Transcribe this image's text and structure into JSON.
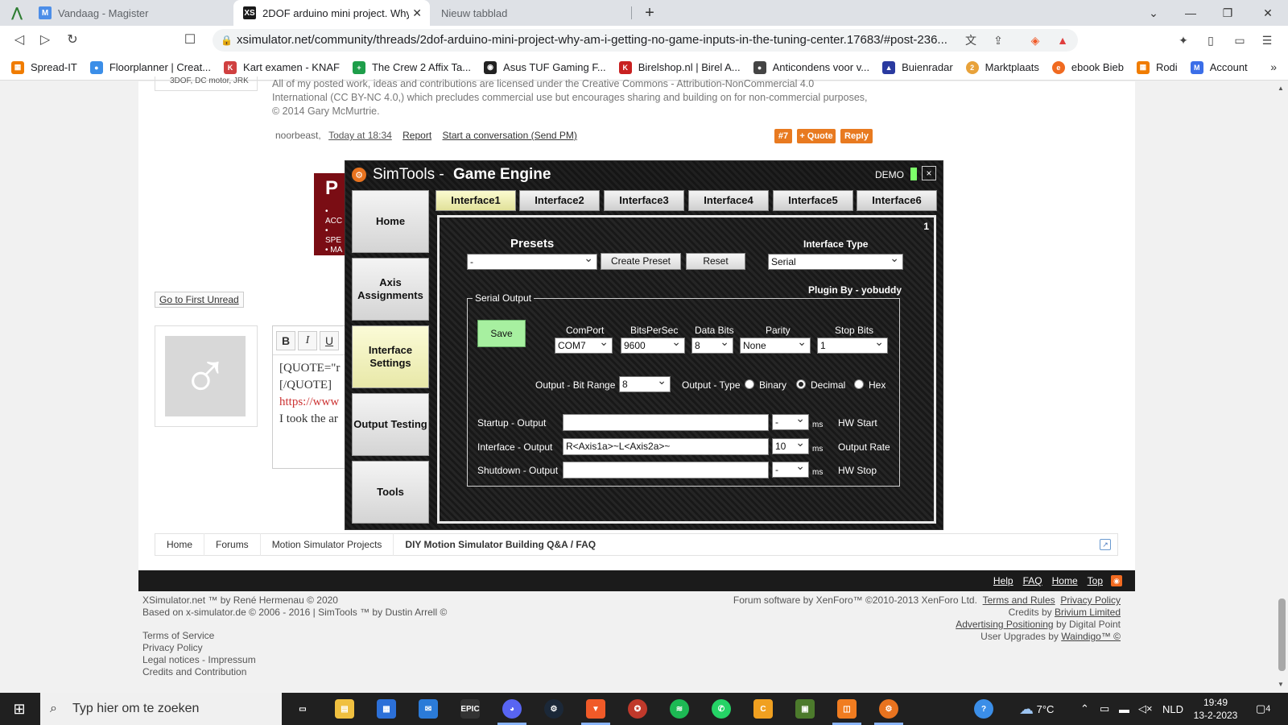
{
  "browser": {
    "tabs": [
      {
        "title": "Vandaag - Magister",
        "icon": "M",
        "color": "#4c8ee8"
      },
      {
        "title": "2DOF arduino mini project. Why a",
        "icon": "XS",
        "color": "#1a1a1a"
      },
      {
        "title": "Nieuw tabblad"
      }
    ],
    "url": "xsimulator.net/community/threads/2dof-arduino-mini-project-why-am-i-getting-no-game-inputs-in-the-tuning-center.17683/#post-236...",
    "bookmarks": [
      {
        "label": "Spread-IT",
        "color": "#f07c00"
      },
      {
        "label": "Floorplanner | Creat...",
        "color": "#3b8ee8"
      },
      {
        "label": "Kart examen - KNAF",
        "color": "#d04040"
      },
      {
        "label": "The Crew 2 Affix Ta...",
        "color": "#1e9e4a"
      },
      {
        "label": "Asus TUF Gaming F...",
        "color": "#222222"
      },
      {
        "label": "Birelshop.nl | Birel A...",
        "color": "#c82020"
      },
      {
        "label": "Anticondens voor v...",
        "color": "#444444"
      },
      {
        "label": "Buienradar",
        "color": "#2a3aa0"
      },
      {
        "label": "Marktplaats",
        "color": "#e8a23a"
      },
      {
        "label": "ebook Bieb",
        "color": "#f06a20"
      },
      {
        "label": "Rodi",
        "color": "#f07c00"
      },
      {
        "label": "Account",
        "color": "#3b6ee8"
      }
    ]
  },
  "post": {
    "signature": "All of my posted work, ideas and contributions are licensed under the Creative Commons - Attribution-NonCommercial 4.0 International (CC BY-NC 4.0,) which precludes commercial use but encourages sharing and building on for non-commercial purposes, © 2014 Gary McMurtrie.",
    "author_line": "3DOF, DC motor, JRK",
    "author": "noorbeast,",
    "time": "Today at 18:34",
    "report": "Report",
    "conversation": "Start a conversation (Send PM)",
    "num": "#7",
    "quote": "+ Quote",
    "reply": "Reply",
    "ad_text": [
      "P",
      "• ACC",
      "• SPE",
      "• MA"
    ],
    "first_unread": "Go to First Unread"
  },
  "editor": {
    "bold": "B",
    "italic": "I",
    "underline": "U",
    "lines": [
      "[QUOTE=\"r",
      "[/QUOTE]",
      "https://www",
      "I took the ar"
    ]
  },
  "simtools": {
    "title_light": "SimTools",
    "title_bold": "Game Engine",
    "demo": "DEMO",
    "close": "×",
    "sidebar": [
      "Home",
      "Axis Assignments",
      "Interface Settings",
      "Output Testing",
      "Tools"
    ],
    "tabs": [
      "Interface1",
      "Interface2",
      "Interface3",
      "Interface4",
      "Interface5",
      "Interface6"
    ],
    "panel_num": "1",
    "presets_label": "Presets",
    "preset_value": "-",
    "create_preset": "Create Preset",
    "reset": "Reset",
    "interface_type_label": "Interface Type",
    "interface_type": "Serial",
    "plugin_by": "Plugin By - yobuddy",
    "serial_output": "Serial Output",
    "save": "Save",
    "comport_label": "ComPort",
    "comport": "COM7",
    "bits_label": "BitsPerSec",
    "bits": "9600",
    "databits_label": "Data Bits",
    "databits": "8",
    "parity_label": "Parity",
    "parity": "None",
    "stopbits_label": "Stop Bits",
    "stopbits": "1",
    "bitrange_label": "Output - Bit Range",
    "bitrange": "8",
    "outtype_label": "Output - Type",
    "binary": "Binary",
    "decimal": "Decimal",
    "hex": "Hex",
    "startup_label": "Startup - Output",
    "startup_value": "",
    "startup_ms": "-",
    "hw_start": "HW Start",
    "interface_label": "Interface - Output",
    "interface_value": "R<Axis1a>~L<Axis2a>~",
    "interface_ms": "10",
    "output_rate": "Output Rate",
    "shutdown_label": "Shutdown - Output",
    "shutdown_value": "",
    "shutdown_ms": "-",
    "hw_stop": "HW Stop",
    "ms": "ms"
  },
  "breadcrumb": [
    "Home",
    "Forums",
    "Motion Simulator Projects",
    "DIY Motion Simulator Building Q&A / FAQ"
  ],
  "footer": {
    "links": [
      "Help",
      "FAQ",
      "Home",
      "Top"
    ],
    "left1": "XSimulator.net ™ by René Hermenau © 2020",
    "left2": "Based on x-simulator.de © 2006 - 2016 | SimTools ™ by Dustin Arrell ©",
    "legal": [
      "Terms of Service",
      "Privacy Policy",
      "Legal notices - Impressum",
      "Credits and Contribution"
    ],
    "right1_text": "Forum software by XenForo™ ©2010-2013 XenForo Ltd.",
    "terms": "Terms and Rules",
    "privacy": "Privacy Policy",
    "credits_prefix": "Credits by",
    "credits_link": "Brivium Limited",
    "adv_link": "Advertising Positioning",
    "adv_suffix": "by Digital Point",
    "upgr_prefix": "User Upgrades by",
    "upgr_link": "Waindigo™ ©"
  },
  "taskbar": {
    "search_placeholder": "Typ hier om te zoeken",
    "weather": "7°C",
    "lang": "NLD",
    "time": "19:49",
    "date": "13-2-2023",
    "notif": "4"
  }
}
